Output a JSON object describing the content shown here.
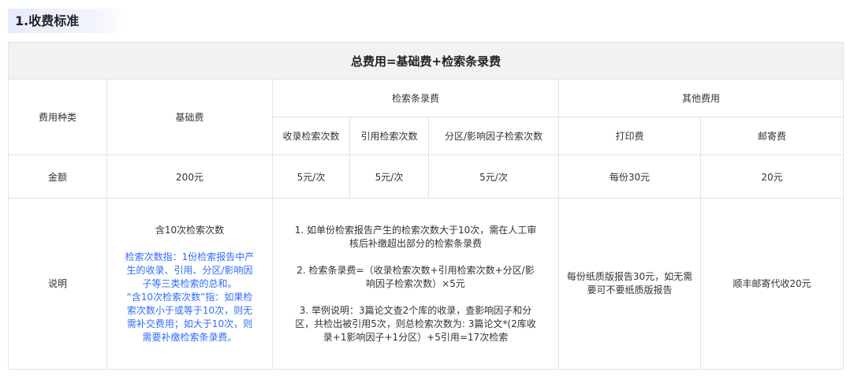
{
  "section": {
    "title": "1.收费标准"
  },
  "table": {
    "header": "总费用=基础费+检索条录费",
    "labels": {
      "fee_type": "费用种类",
      "basic_fee": "基础费",
      "retrieval_fee": "检索条录费",
      "other_fee": "其他费用",
      "amount": "金额",
      "description": "说明"
    },
    "sub_headers": {
      "included": "收录检索次数",
      "cited": "引用检索次数",
      "partition": "分区/影响因子检索次数",
      "print": "打印费",
      "mail": "邮寄费"
    },
    "amounts": {
      "basic": "200元",
      "included": "5元/次",
      "cited": "5元/次",
      "partition": "5元/次",
      "print": "每份30元",
      "mail": "20元"
    },
    "descriptions": {
      "basic_main": "含10次检索次数",
      "basic_note1": "检索次数指：1份检索报告中产生的收录、引用、分区/影响因子等三类检索的总和。",
      "basic_note2": "“含10次检索次数”指：如果检索次数小于或等于10次，则无需补交费用；如大于10次，则需要补缴检索条录费。",
      "retrieval_1": "1. 如单份检索报告产生的检索次数大于10次，需在人工审核后补缴超出部分的检索条录费",
      "retrieval_2": "2. 检索条录费=（收录检索次数+引用检索次数+分区/影响因子检索次数）×5元",
      "retrieval_3": "3. 举例说明：3篇论文查2个库的收录，查影响因子和分区，共检出被引用5次，则总检索次数为: 3篇论文*(2库收录+1影响因子+1分区）+5引用=17次检索",
      "print": "每份纸质版报告30元，如无需要可不要纸质版报告",
      "mail": "顺丰邮寄代收20元"
    }
  }
}
